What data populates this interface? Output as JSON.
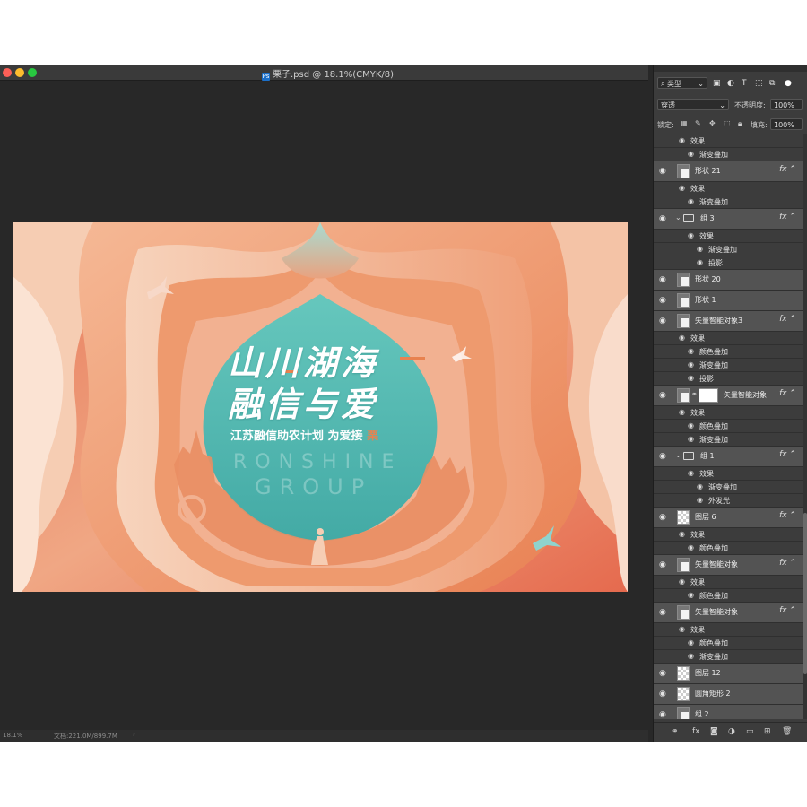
{
  "window": {
    "document_title": "栗子.psd @ 18.1%(CMYK/8)",
    "file_icon": "photoshop-file-icon"
  },
  "canvas": {
    "headline_line1": "山川湖海",
    "headline_line2": "融信与爱",
    "subline": "江苏融信助农计划 为爱接",
    "subline_accent": "栗",
    "brand_line1": "RONSHINE",
    "brand_line2": "GROUP"
  },
  "status": {
    "zoom": "18.1%",
    "doc_info": "文档:221.0M/899.7M"
  },
  "panel": {
    "filter_type": "类型",
    "blend_mode": "穿透",
    "opacity_label": "不透明度:",
    "opacity_value": "100%",
    "lock_label": "锁定:",
    "fill_label": "填充:",
    "fill_value": "100%"
  },
  "layers": [
    {
      "kind": "sub",
      "text": "效果",
      "indent": 1
    },
    {
      "kind": "sub",
      "text": "渐变叠加",
      "indent": 2
    },
    {
      "kind": "layer",
      "name": "形状 21",
      "fx": true,
      "thumb": "shape"
    },
    {
      "kind": "sub",
      "text": "效果",
      "indent": 1
    },
    {
      "kind": "sub",
      "text": "渐变叠加",
      "indent": 2
    },
    {
      "kind": "group",
      "name": "组 3",
      "fx": true
    },
    {
      "kind": "sub",
      "text": "效果",
      "indent": 2
    },
    {
      "kind": "sub",
      "text": "渐变叠加",
      "indent": 3
    },
    {
      "kind": "sub",
      "text": "投影",
      "indent": 3
    },
    {
      "kind": "layer",
      "name": "形状 20",
      "fx": false,
      "thumb": "shape"
    },
    {
      "kind": "layer",
      "name": "形状 1",
      "fx": false,
      "thumb": "shape"
    },
    {
      "kind": "layer",
      "name": "矢量智能对象3",
      "fx": true,
      "thumb": "smart"
    },
    {
      "kind": "sub",
      "text": "效果",
      "indent": 1
    },
    {
      "kind": "sub",
      "text": "颜色叠加",
      "indent": 2
    },
    {
      "kind": "sub",
      "text": "渐变叠加",
      "indent": 2
    },
    {
      "kind": "sub",
      "text": "投影",
      "indent": 2
    },
    {
      "kind": "layer",
      "name": "矢量智能对象",
      "fx": true,
      "thumb": "smart-mask"
    },
    {
      "kind": "sub",
      "text": "效果",
      "indent": 1
    },
    {
      "kind": "sub",
      "text": "颜色叠加",
      "indent": 2
    },
    {
      "kind": "sub",
      "text": "渐变叠加",
      "indent": 2
    },
    {
      "kind": "group",
      "name": "组 1",
      "fx": true
    },
    {
      "kind": "sub",
      "text": "效果",
      "indent": 2
    },
    {
      "kind": "sub",
      "text": "渐变叠加",
      "indent": 3
    },
    {
      "kind": "sub",
      "text": "外发光",
      "indent": 3
    },
    {
      "kind": "layer",
      "name": "图层 6",
      "fx": true,
      "thumb": "pixel"
    },
    {
      "kind": "sub",
      "text": "效果",
      "indent": 1
    },
    {
      "kind": "sub",
      "text": "颜色叠加",
      "indent": 2
    },
    {
      "kind": "layer",
      "name": "矢量智能对象",
      "fx": true,
      "thumb": "smart"
    },
    {
      "kind": "sub",
      "text": "效果",
      "indent": 1
    },
    {
      "kind": "sub",
      "text": "颜色叠加",
      "indent": 2
    },
    {
      "kind": "layer",
      "name": "矢量智能对象",
      "fx": true,
      "thumb": "smart"
    },
    {
      "kind": "sub",
      "text": "效果",
      "indent": 1
    },
    {
      "kind": "sub",
      "text": "颜色叠加",
      "indent": 2
    },
    {
      "kind": "sub",
      "text": "渐变叠加",
      "indent": 2
    },
    {
      "kind": "layer",
      "name": "图层 12",
      "fx": false,
      "thumb": "pixel"
    },
    {
      "kind": "layer",
      "name": "圆角矩形 2",
      "fx": false,
      "thumb": "pixel"
    },
    {
      "kind": "layer",
      "name": "组 2",
      "fx": false,
      "thumb": "smart"
    }
  ],
  "colors": {
    "canvas_outer": "#ec8a63",
    "canvas_inner": "#52bbb0",
    "accent": "#e8824f"
  }
}
